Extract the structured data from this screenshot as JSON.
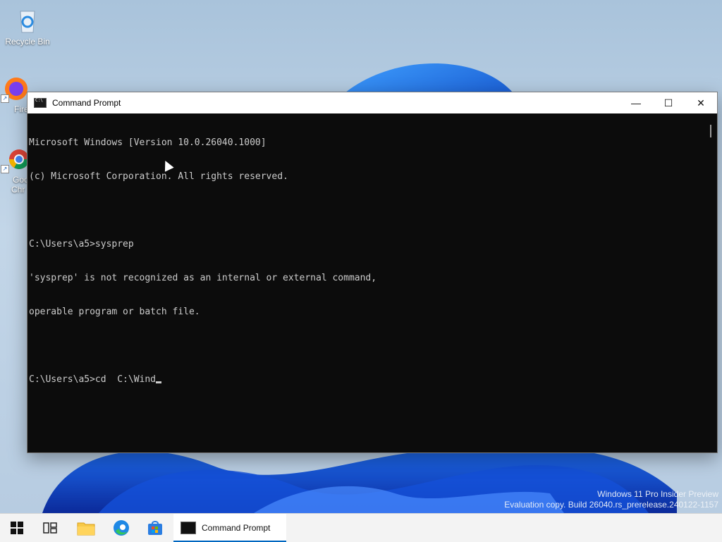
{
  "desktop": {
    "icons": [
      {
        "label": "Recycle Bin",
        "icon": "recycle-bin-icon"
      },
      {
        "label": "Fire",
        "icon": "firefox-icon"
      },
      {
        "label": "Goo",
        "label2": "Chr",
        "icon": "chrome-icon"
      }
    ],
    "watermark": {
      "line1": "Windows 11 Pro Insider Preview",
      "line2": "Evaluation copy. Build 26040.rs_prerelease.240122-1157"
    }
  },
  "window": {
    "title": "Command Prompt",
    "icon": "cmd-icon",
    "controls": {
      "minimize": "—",
      "maximize": "☐",
      "close": "✕"
    },
    "console_lines": [
      "Microsoft Windows [Version 10.0.26040.1000]",
      "(c) Microsoft Corporation. All rights reserved.",
      "",
      "C:\\Users\\a5>sysprep",
      "'sysprep' is not recognized as an internal or external command,",
      "operable program or batch file.",
      "",
      "C:\\Users\\a5>cd  C:\\Wind"
    ]
  },
  "taskbar": {
    "items": [
      {
        "name": "start-button",
        "icon": "windows-logo-icon"
      },
      {
        "name": "task-view-button",
        "icon": "task-view-icon"
      },
      {
        "name": "file-explorer-button",
        "icon": "folder-icon"
      },
      {
        "name": "edge-button",
        "icon": "edge-icon"
      },
      {
        "name": "store-button",
        "icon": "store-icon"
      }
    ],
    "active_app": "Command Prompt"
  },
  "colors": {
    "console_bg": "#0c0c0c",
    "console_fg": "#cccccc",
    "accent": "#0067c0"
  }
}
